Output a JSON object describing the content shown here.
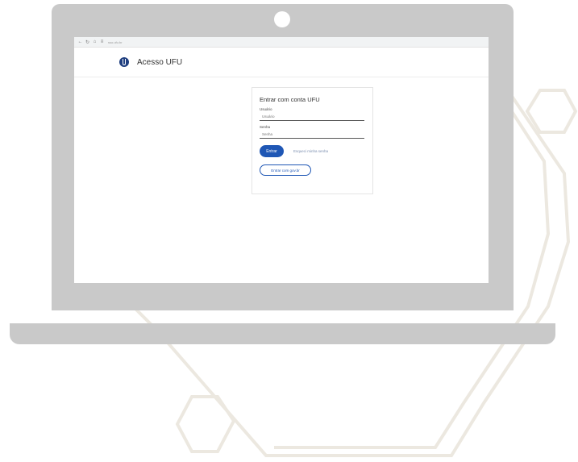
{
  "browser": {
    "back_icon": "arrow-left-icon",
    "reload_icon": "reload-icon",
    "home_icon": "home-icon",
    "site_info_icon": "tune-icon",
    "url": "sso.ufu.br"
  },
  "header": {
    "logo_icon": "ufu-logo-icon",
    "title": "Acesso UFU"
  },
  "login": {
    "title": "Entrar com conta UFU",
    "user_label": "Usuário",
    "user_placeholder": "Usuário",
    "password_label": "Senha",
    "password_placeholder": "Senha",
    "submit_label": "Entrar",
    "forgot_label": "Esqueci minha senha",
    "govbr_label": "Entrar com gov.br"
  },
  "colors": {
    "laptop_gray": "#c9c9c9",
    "primary_blue": "#1f57b5",
    "decor_outline": "#ece8e0"
  }
}
